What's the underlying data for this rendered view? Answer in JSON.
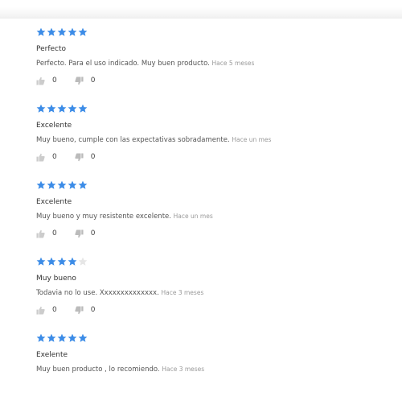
{
  "colors": {
    "star_filled": "#3c8ce7",
    "star_empty": "#e6e6e6",
    "thumb_up": "#cccccc",
    "thumb_down": "#bbbbbb"
  },
  "reviews": [
    {
      "rating": 5,
      "title": "Perfecto",
      "text": "Perfecto. Para el uso indicado. Muy buen producto.",
      "ago": "Hace 5 meses",
      "likes": "0",
      "dislikes": "0"
    },
    {
      "rating": 5,
      "title": "Excelente",
      "text": "Muy bueno, cumple con las expectativas sobradamente.",
      "ago": "Hace un mes",
      "likes": "0",
      "dislikes": "0"
    },
    {
      "rating": 5,
      "title": "Excelente",
      "text": "Muy bueno y muy resistente excelente.",
      "ago": "Hace un mes",
      "likes": "0",
      "dislikes": "0"
    },
    {
      "rating": 4,
      "title": "Muy bueno",
      "text": "Todavia no lo use. Xxxxxxxxxxxxxx.",
      "ago": "Hace 3 meses",
      "likes": "0",
      "dislikes": "0"
    },
    {
      "rating": 5,
      "title": "Exelente",
      "text": "Muy buen producto , lo recomiendo.",
      "ago": "Hace 3 meses"
    }
  ]
}
